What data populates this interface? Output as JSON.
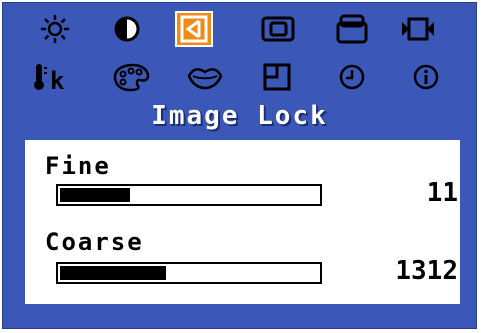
{
  "menu": {
    "title": "Image Lock",
    "icons_row1": [
      {
        "name": "brightness-icon",
        "selected": false
      },
      {
        "name": "contrast-icon",
        "selected": false
      },
      {
        "name": "image-lock-icon",
        "selected": true
      },
      {
        "name": "position-icon",
        "selected": false
      },
      {
        "name": "size-icon",
        "selected": false
      },
      {
        "name": "video-icon",
        "selected": false
      }
    ],
    "icons_row2": [
      {
        "name": "color-temperature-icon",
        "label": "k",
        "selected": false
      },
      {
        "name": "color-palette-icon",
        "selected": false
      },
      {
        "name": "lips-icon",
        "selected": false
      },
      {
        "name": "window-position-icon",
        "selected": false
      },
      {
        "name": "clock-icon",
        "selected": false
      },
      {
        "name": "information-icon",
        "selected": false
      }
    ]
  },
  "settings": [
    {
      "label": "Fine",
      "value": "11",
      "level_fraction": 0.27
    },
    {
      "label": "Coarse",
      "value": "1312",
      "level_fraction": 0.41
    }
  ],
  "colors": {
    "background": "#3b57b8",
    "selected": "#f28a16",
    "panel": "#ffffff",
    "text": "#000000"
  }
}
